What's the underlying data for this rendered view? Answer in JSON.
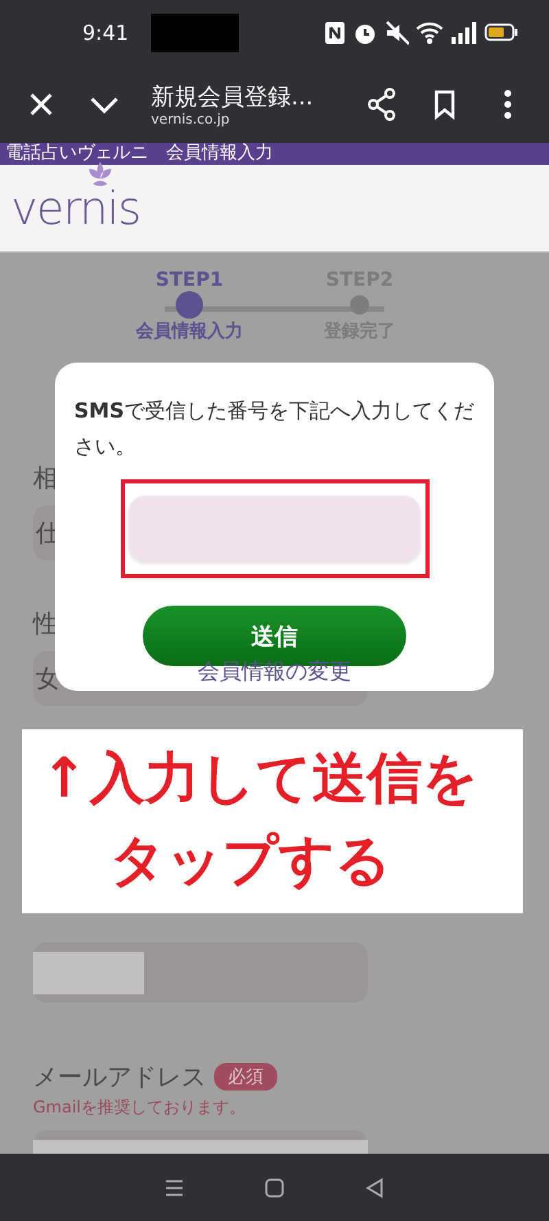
{
  "status_bar": {
    "time": "9:41"
  },
  "browser": {
    "title": "新規会員登録...",
    "url": "vernis.co.jp"
  },
  "site_banner": "電話占いヴェルニ　会員情報入力",
  "logo": {
    "wordmark": "vernis"
  },
  "steps": [
    {
      "step": "STEP1",
      "label": "会員情報入力",
      "selected": true
    },
    {
      "step": "STEP2",
      "label": "登録完了",
      "selected": false
    }
  ],
  "background_form": [
    {
      "kind": "field",
      "label": "相",
      "value": "仕"
    },
    {
      "kind": "field",
      "label": "性",
      "value": "女"
    },
    {
      "kind": "redacted"
    },
    {
      "kind": "email",
      "label": "メールアドレス",
      "badge": "必須",
      "note": "Gmailを推奨しております。"
    }
  ],
  "modal": {
    "message": "**SMS**で受信した番号を下記へ入力してください。",
    "submit": "送信",
    "link": "会員情報の変更"
  },
  "annotation": {
    "arrow": "↑",
    "lines": [
      "入力して送信を",
      "タップする"
    ]
  }
}
